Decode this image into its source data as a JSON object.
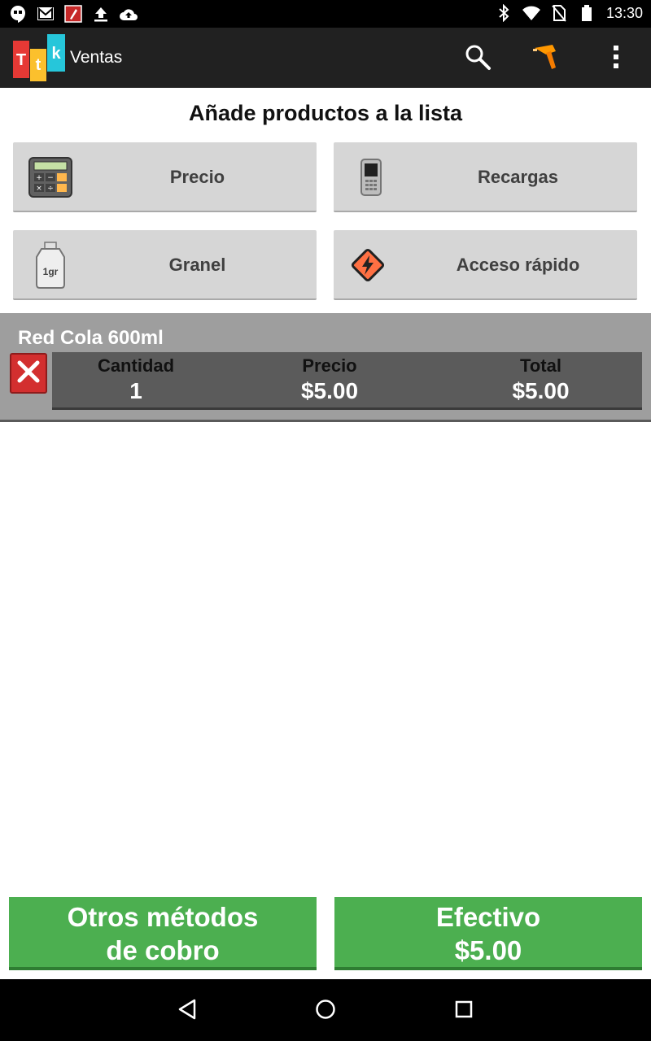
{
  "status_bar": {
    "time": "13:30",
    "left_icons": [
      "hangouts-icon",
      "gmail-icon",
      "app-notification-icon",
      "upload-icon",
      "cloud-upload-icon"
    ],
    "right_icons": [
      "bluetooth-icon",
      "wifi-icon",
      "no-sim-icon",
      "battery-icon"
    ]
  },
  "appbar": {
    "logo_letters": [
      "T",
      "t",
      "k"
    ],
    "title": "Ventas",
    "actions": [
      "search-icon",
      "barcode-scanner-icon",
      "overflow-menu-icon"
    ]
  },
  "main": {
    "section_title": "Añade productos a la lista",
    "tiles": [
      {
        "label": "Precio",
        "icon": "calculator-icon"
      },
      {
        "label": "Recargas",
        "icon": "phone-icon"
      },
      {
        "label": "Granel",
        "icon": "weight-icon",
        "icon_text": "1gr"
      },
      {
        "label": "Acceso rápido",
        "icon": "lightning-icon"
      }
    ]
  },
  "cart": {
    "items": [
      {
        "name": "Red Cola 600ml",
        "headers": {
          "quantity": "Cantidad",
          "price": "Precio",
          "total": "Total"
        },
        "quantity": "1",
        "price": "$5.00",
        "total": "$5.00"
      }
    ]
  },
  "footer": {
    "other_methods_line1": "Otros métodos",
    "other_methods_line2": "de cobro",
    "cash_label": "Efectivo",
    "cash_amount": "$5.00"
  },
  "colors": {
    "appbar": "#212121",
    "accent_green": "#4caf50",
    "delete_red": "#d32f2f",
    "tile_bg": "#d6d6d6",
    "cart_bg": "#9e9e9e"
  },
  "navbar": {
    "buttons": [
      "back-icon",
      "home-icon",
      "recents-icon"
    ]
  }
}
